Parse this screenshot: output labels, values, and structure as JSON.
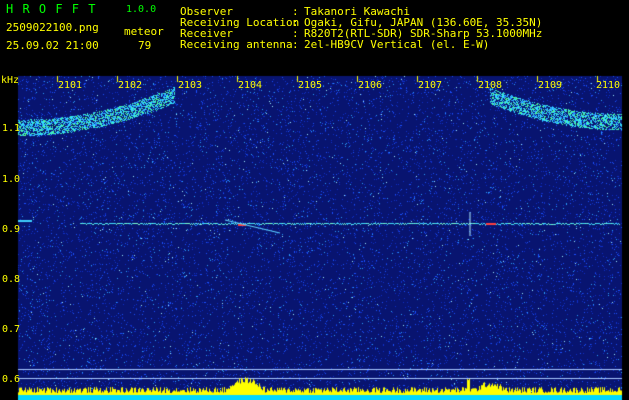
{
  "app": {
    "title": "H R O F F T",
    "version": "1.0.0",
    "filename": "2509022100.png",
    "timestamp": "25.09.02 21:00",
    "mode_label": "meteor",
    "count": "79"
  },
  "info": {
    "labels": [
      "Observer",
      "Receiving Location",
      "Receiver",
      "Receiving antenna"
    ],
    "values": [
      "Takanori Kawachi",
      "Ogaki, Gifu, JAPAN (136.60E, 35.35N)",
      "R820T2(RTL-SDR) SDR-Sharp 53.1000MHz",
      "2el-HB9CV Vertical (el. E-W)"
    ]
  },
  "axis": {
    "unit": "kHz",
    "time_ticks": [
      "2101",
      "2102",
      "2103",
      "2104",
      "2105",
      "2106",
      "2107",
      "2108",
      "2109",
      "2110"
    ],
    "freq_ticks": [
      "1.1",
      "1.0",
      "0.9",
      "0.8",
      "0.7",
      "0.6"
    ]
  },
  "colors": {
    "header_text": "#ffff00",
    "title_text": "#00ff00",
    "background": "#000000",
    "noise_base": "#0a1a9a",
    "carrier": "#30c8ff",
    "bottom_band": "#00e0ff",
    "bottom_peaks": "#ffff00"
  }
}
